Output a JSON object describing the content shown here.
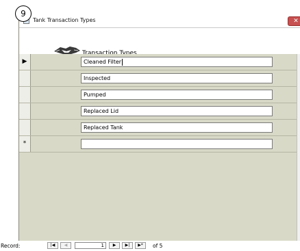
{
  "callout": {
    "number": "9"
  },
  "window": {
    "title": "Tank Transaction Types",
    "close_glyph": "✕"
  },
  "form": {
    "header_title": "Transaction Types"
  },
  "rows": [
    {
      "selector": "▶",
      "value": "Cleaned Filter"
    },
    {
      "selector": "",
      "value": "Inspected"
    },
    {
      "selector": "",
      "value": "Pumped"
    },
    {
      "selector": "",
      "value": "Replaced Lid"
    },
    {
      "selector": "",
      "value": "Replaced Tank"
    },
    {
      "selector": "*",
      "value": ""
    }
  ],
  "nav": {
    "label": "Record:",
    "first": "|◀",
    "prev": "◀",
    "current": "1",
    "next": "▶",
    "last": "▶|",
    "new": "▶*",
    "of_text": "of 5"
  }
}
